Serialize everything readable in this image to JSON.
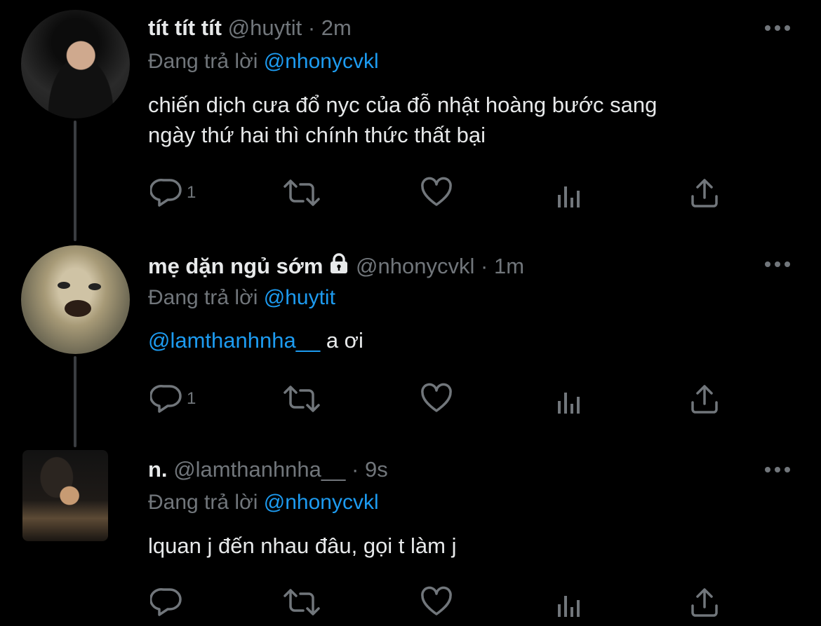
{
  "tweets": [
    {
      "display_name": "tít tít tít",
      "handle": "@huytit",
      "time": "2m",
      "reply_prefix": "Đang trả lời",
      "reply_handle": "@nhonycvkl",
      "text_lines": [
        "chiến dịch cưa đổ nyc của đỗ nhật hoàng bước sang",
        "ngày thứ hai thì chính thức thất bại"
      ],
      "reply_count": "1"
    },
    {
      "display_name": "mẹ dặn ngủ sớm",
      "handle": "@nhonycvkl",
      "time": "1m",
      "reply_prefix": "Đang trả lời",
      "reply_handle": "@huytit",
      "mention": "@lamthanhnha__",
      "text_rest": " a ơi",
      "reply_count": "1"
    },
    {
      "display_name": "n.",
      "handle": "@lamthanhnha__",
      "time": "9s",
      "reply_prefix": "Đang trả lời",
      "reply_handle": "@nhonycvkl",
      "text": "lquan j đến nhau đâu, gọi t làm j",
      "reply_count": ""
    }
  ],
  "separator": "·",
  "icons": [
    "reply-icon",
    "retweet-icon",
    "like-icon",
    "analytics-icon",
    "share-icon",
    "more-icon",
    "lock-icon"
  ],
  "colors": {
    "background": "#000000",
    "text": "#e7e9ea",
    "muted": "#71767b",
    "link": "#1d9bf0"
  }
}
